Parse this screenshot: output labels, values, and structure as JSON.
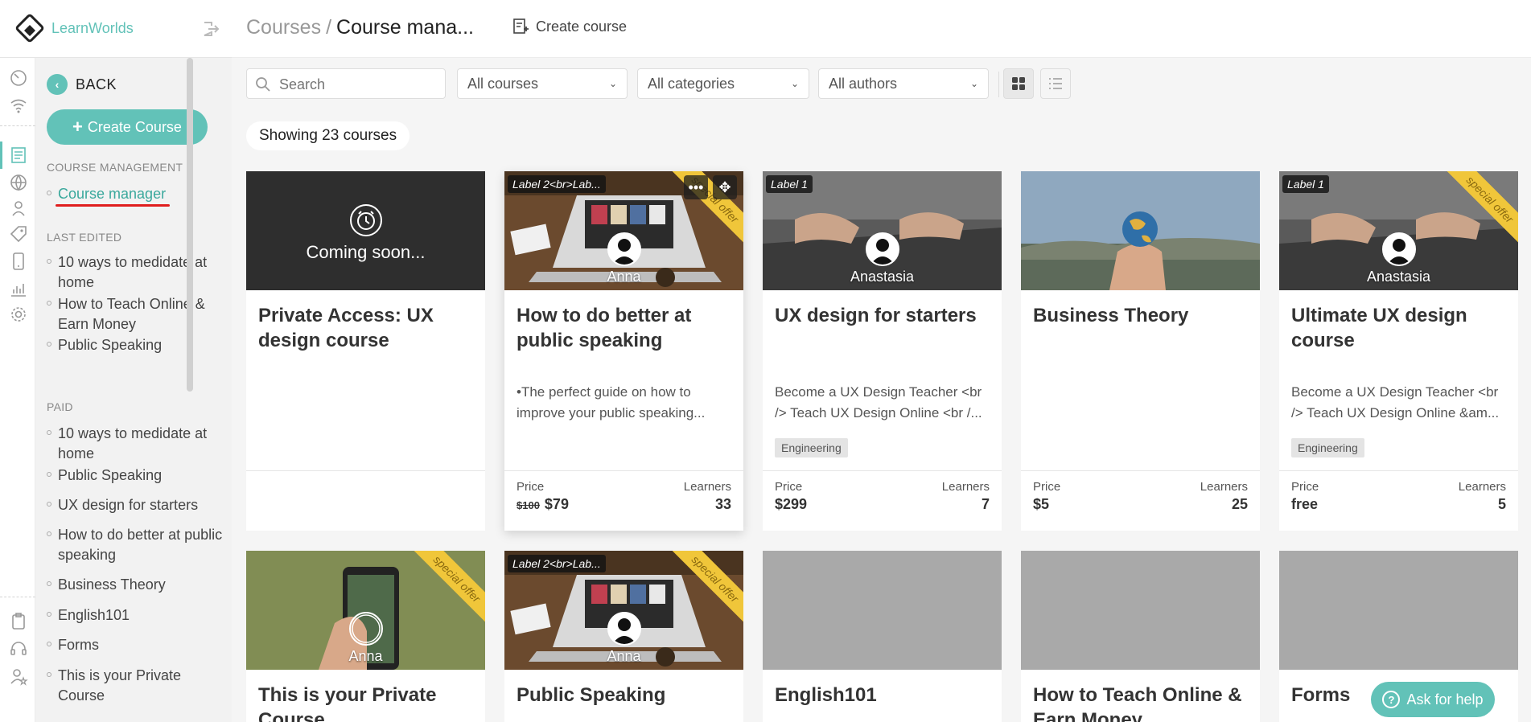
{
  "brand": {
    "name": "LearnWorlds"
  },
  "sidebar": {
    "back_label": "BACK",
    "create_label": "Create Course",
    "sections": [
      {
        "heading": "COURSE MANAGEMENT",
        "items": [
          "Course manager"
        ]
      },
      {
        "heading": "LAST EDITED",
        "items": [
          "10 ways to medidate at home",
          "How to Teach Online & Earn Money",
          "Public Speaking"
        ]
      },
      {
        "heading": "PAID",
        "items": [
          "10 ways to medidate at home",
          "Public Speaking",
          "UX design for starters",
          "How to do better at public speaking",
          "Business Theory",
          "English101",
          "Forms",
          "This is your Private Course"
        ]
      }
    ]
  },
  "header": {
    "breadcrumb_root": "Courses",
    "breadcrumb_sep": "/",
    "breadcrumb_current": "Course mana...",
    "create_course": "Create course"
  },
  "filters": {
    "search_placeholder": "Search",
    "courses": "All courses",
    "categories": "All categories",
    "authors": "All authors"
  },
  "showing": "Showing 23 courses",
  "labels": {
    "price": "Price",
    "learners": "Learners"
  },
  "cards": [
    {
      "title": "Private Access: UX design course",
      "coming_soon": "Coming soon..."
    },
    {
      "title": "How to do better at public speaking",
      "label": "Label 2<br>Lab...",
      "ribbon": "special offer",
      "author": "Anna",
      "desc": "•The perfect guide on how to improve your public speaking...",
      "price_old": "$100",
      "price": "$79",
      "learners": "33"
    },
    {
      "title": "UX design for starters",
      "label": "Label 1",
      "author": "Anastasia",
      "desc": "Become a UX Design Teacher <br /> Teach UX Design Online <br /...",
      "tag": "Engineering",
      "price": "$299",
      "learners": "7"
    },
    {
      "title": "Business Theory",
      "price": "$5",
      "learners": "25"
    },
    {
      "title": "Ultimate UX design course",
      "label": "Label 1",
      "ribbon": "special offer",
      "author": "Anastasia",
      "desc": "Become a UX Design Teacher <br /> Teach UX Design Online &am...",
      "tag": "Engineering",
      "price": "free",
      "learners": "5"
    },
    {
      "title": "This is your Private Course",
      "ribbon": "special offer",
      "author": "Anna"
    },
    {
      "title": "Public Speaking",
      "label": "Label 2<br>Lab...",
      "ribbon": "special offer",
      "author": "Anna"
    },
    {
      "title": "English101"
    },
    {
      "title": "How to Teach Online & Earn Money"
    },
    {
      "title": "Forms"
    }
  ],
  "help": "Ask for help",
  "colors": {
    "accent": "#62c2b8",
    "ribbon": "#f0c63a",
    "active_underline": "#e01e1e"
  }
}
